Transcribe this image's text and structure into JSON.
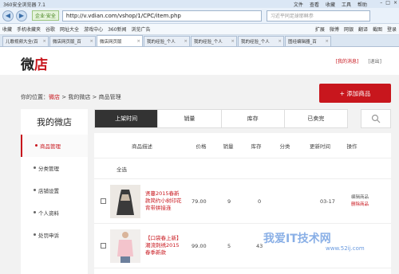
{
  "browser": {
    "title": "360安全浏览器 7.1",
    "menus": [
      "文件",
      "查看",
      "收藏",
      "工具",
      "帮助"
    ],
    "safe_label": "企业·安全",
    "url": "http://v.vdian.com/vshop/1/CPC/item.php",
    "search_placeholder": "习近平同足球耶稣参",
    "favorites": [
      "收藏",
      "手机收藏夹",
      "谷歌",
      "网址大全",
      "游戏中心",
      "360新闻",
      "浏览广告"
    ],
    "favorites_right": [
      "扩展",
      "微博",
      "网银",
      "翻译",
      "截图",
      "登录"
    ],
    "tabs": [
      {
        "label": "儿歌视频大全(百",
        "active": false
      },
      {
        "label": "微店网页版_百",
        "active": false
      },
      {
        "label": "微店网页版",
        "active": true
      },
      {
        "label": "我的经验_个人",
        "active": false
      },
      {
        "label": "我的经验_个人",
        "active": false
      },
      {
        "label": "我的经验_个人",
        "active": false
      },
      {
        "label": "图经编辑器_百",
        "active": false
      }
    ]
  },
  "header": {
    "logo_prefix": "微",
    "logo_suffix": "店",
    "my_messages": "[我的消息]",
    "exit": "[退出]"
  },
  "breadcrumb": {
    "prefix": "你的位置：",
    "item1": "微店",
    "item2": "我的微店",
    "item3": "商品管理",
    "sep": " > "
  },
  "add_button": "+ 添加商品",
  "sidebar": {
    "title": "我的微店",
    "items": [
      {
        "label": "商品管理",
        "active": true
      },
      {
        "label": "分类管理",
        "active": false
      },
      {
        "label": "店铺设置",
        "active": false
      },
      {
        "label": "个人资料",
        "active": false
      },
      {
        "label": "处罚申诉",
        "active": false
      }
    ]
  },
  "filter_tabs": [
    "上架时间",
    "销量",
    "库存",
    "已卖完"
  ],
  "table": {
    "headers": [
      "商品描述",
      "价格",
      "销量",
      "库存",
      "分类",
      "更新时间",
      "操作"
    ],
    "select_all": "全选",
    "rows": [
      {
        "desc": "贤蔓2015春新款简约小树印花背带拼接连",
        "price": "79.00",
        "sales": "9",
        "stock": "0",
        "category": "",
        "updated": "03-17",
        "op_edit": "编辑商品",
        "op_delete": "删除商品"
      },
      {
        "desc": "【口袋春上新】潮流刺绣2015春季新款",
        "price": "99.00",
        "sales": "5",
        "stock": "43",
        "category": "",
        "updated": "",
        "op_edit": "",
        "op_delete": ""
      }
    ]
  },
  "watermark": "我爱IT技术网",
  "watermark_url": "www.52ij.com"
}
